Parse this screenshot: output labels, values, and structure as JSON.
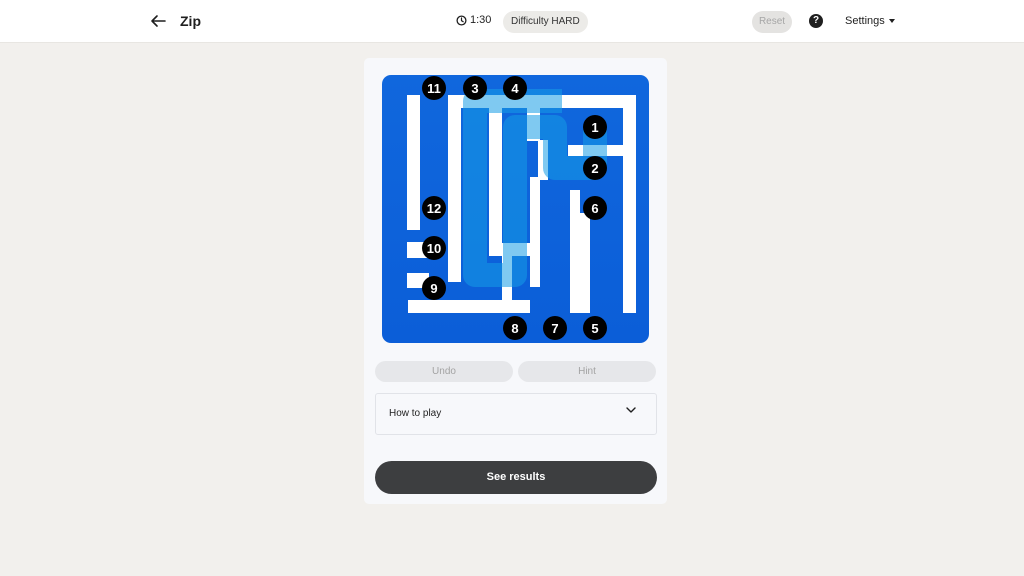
{
  "header": {
    "title": "Zip",
    "timer": "1:30",
    "difficulty": "Difficulty HARD",
    "reset_label": "Reset",
    "help_label": "?",
    "settings_label": "Settings"
  },
  "board": {
    "grid_size": 6,
    "path_colors": {
      "start": "#1aa3e8",
      "end": "#0a4fd6"
    },
    "numbers": [
      {
        "label": "1",
        "cell": [
          5,
          1
        ]
      },
      {
        "label": "2",
        "cell": [
          5,
          2
        ]
      },
      {
        "label": "3",
        "cell": [
          2,
          0
        ]
      },
      {
        "label": "4",
        "cell": [
          3,
          0
        ]
      },
      {
        "label": "5",
        "cell": [
          5,
          6
        ]
      },
      {
        "label": "6",
        "cell": [
          5,
          3
        ]
      },
      {
        "label": "7",
        "cell": [
          4,
          6
        ]
      },
      {
        "label": "8",
        "cell": [
          3,
          6
        ]
      },
      {
        "label": "9",
        "cell": [
          1,
          5
        ]
      },
      {
        "label": "10",
        "cell": [
          1,
          4
        ]
      },
      {
        "label": "11",
        "cell": [
          1,
          0
        ]
      },
      {
        "label": "12",
        "cell": [
          1,
          3
        ]
      }
    ]
  },
  "controls": {
    "undo_label": "Undo",
    "hint_label": "Hint",
    "how_to_play_label": "How to play",
    "see_results_label": "See results"
  }
}
